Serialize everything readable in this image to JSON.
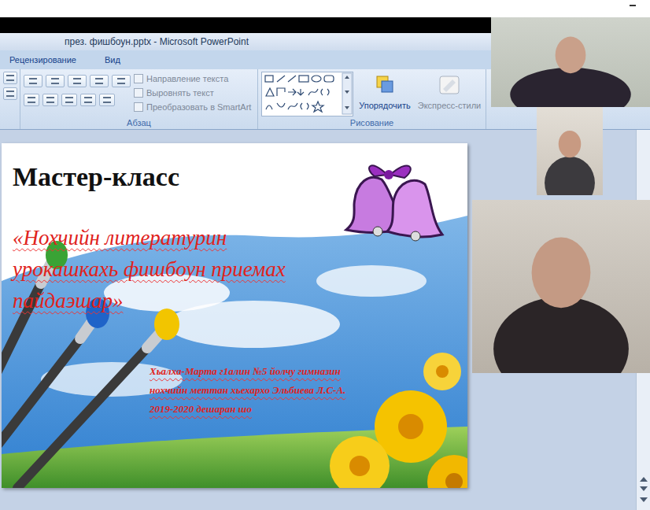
{
  "window": {
    "title": "през. фишбоун.pptx - Microsoft PowerPoint"
  },
  "ribbon": {
    "tabs": [
      {
        "label": "Рецензирование",
        "selected": false
      },
      {
        "label": "Вид",
        "selected": false
      }
    ],
    "paragraph_group": {
      "label": "Абзац",
      "items": [
        {
          "label": "Направление текста",
          "disabled": true
        },
        {
          "label": "Выровнять текст",
          "disabled": true
        },
        {
          "label": "Преобразовать в SmartArt",
          "disabled": true
        }
      ]
    },
    "drawing_group": {
      "label": "Рисование",
      "items": [
        {
          "label": "Упорядочить",
          "disabled": false
        },
        {
          "label": "Экспресс-стили",
          "disabled": true
        }
      ]
    }
  },
  "slide": {
    "title": "Мастер-класс",
    "subtitle_lines": [
      "«Нохчийн литературин",
      "урокашкахь фишбоун приемах",
      "пайдаэшар»"
    ],
    "author_lines": [
      "Хьалха-Марта г1алин №5 йолчу гимназин",
      "нохчийн меттан хьехархо Эльбиева Л.С-А.",
      "2019-2020 дешаран шо"
    ]
  }
}
